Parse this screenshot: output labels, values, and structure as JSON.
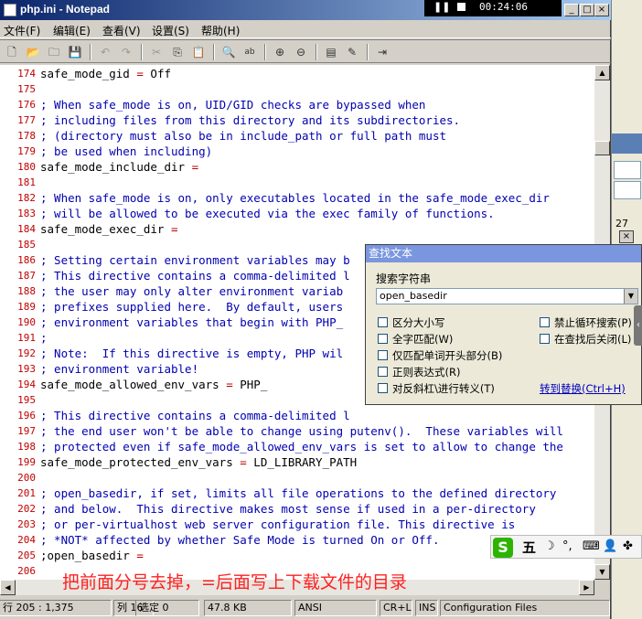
{
  "window": {
    "title": "php.ini - Notepad",
    "caption_buttons": [
      "_",
      "□",
      "×"
    ]
  },
  "media_overlay": {
    "time": "00:24:06"
  },
  "menu": [
    "文件(F)",
    "编辑(E)",
    "查看(V)",
    "设置(S)",
    "帮助(H)"
  ],
  "editor": {
    "lines": [
      {
        "n": "174",
        "key": "safe_mode_gid",
        "op": " = ",
        "val": "Off"
      },
      {
        "n": "175",
        "text": ""
      },
      {
        "n": "176",
        "comment": "; When safe_mode is on, UID/GID checks are bypassed when"
      },
      {
        "n": "177",
        "comment": "; including files from this directory and its subdirectories."
      },
      {
        "n": "178",
        "comment": "; (directory must also be in include_path or full path must"
      },
      {
        "n": "179",
        "comment": "; be used when including)"
      },
      {
        "n": "180",
        "key": "safe_mode_include_dir",
        "op": " =",
        "val": ""
      },
      {
        "n": "181",
        "text": ""
      },
      {
        "n": "182",
        "comment": "; When safe_mode is on, only executables located in the safe_mode_exec_dir"
      },
      {
        "n": "183",
        "comment": "; will be allowed to be executed via the exec family of functions."
      },
      {
        "n": "184",
        "key": "safe_mode_exec_dir",
        "op": " =",
        "val": ""
      },
      {
        "n": "185",
        "text": ""
      },
      {
        "n": "186",
        "comment": "; Setting certain environment variables may b"
      },
      {
        "n": "187",
        "comment": "; This directive contains a comma-delimited l"
      },
      {
        "n": "188",
        "comment": "; the user may only alter environment variab"
      },
      {
        "n": "189",
        "comment": "; prefixes supplied here.  By default, users"
      },
      {
        "n": "190",
        "comment": "; environment variables that begin with PHP_"
      },
      {
        "n": "191",
        "comment": ";"
      },
      {
        "n": "192",
        "comment": "; Note:  If this directive is empty, PHP wil"
      },
      {
        "n": "193",
        "comment": "; environment variable!"
      },
      {
        "n": "194",
        "key": "safe_mode_allowed_env_vars",
        "op": " = ",
        "val": "PHP_"
      },
      {
        "n": "195",
        "text": ""
      },
      {
        "n": "196",
        "comment": "; This directive contains a comma-delimited l"
      },
      {
        "n": "197",
        "comment": "; the end user won't be able to change using putenv().  These variables will"
      },
      {
        "n": "198",
        "comment": "; protected even if safe_mode_allowed_env_vars is set to allow to change the"
      },
      {
        "n": "199",
        "key": "safe_mode_protected_env_vars",
        "op": " = ",
        "val": "LD_LIBRARY_PATH"
      },
      {
        "n": "200",
        "text": ""
      },
      {
        "n": "201",
        "comment": "; open_basedir, if set, limits all file operations to the defined directory"
      },
      {
        "n": "202",
        "comment": "; and below.  This directive makes most sense if used in a per-directory"
      },
      {
        "n": "203",
        "comment": "; or per-virtualhost web server configuration file. This directive is"
      },
      {
        "n": "204",
        "comment": "; *NOT* affected by whether Safe Mode is turned On or Off."
      },
      {
        "n": "205",
        "key": ";open_basedir",
        "op": " =",
        "val": ""
      },
      {
        "n": "206",
        "text": ""
      }
    ]
  },
  "annotation": "把前面分号去掉，=后面写上下载文件的目录",
  "statusbar": {
    "position": "行 205 : 1,375",
    "column": "列 16",
    "selection": "选定 0",
    "size": "47.8 KB",
    "encoding": "ANSI",
    "line_ending": "CR+LF",
    "mode": "INS",
    "scheme": "Configuration Files"
  },
  "find_dialog": {
    "title": "查找文本",
    "search_label": "搜索字符串",
    "search_value": "open_basedir",
    "options_left": [
      "区分大小写",
      "全字匹配(W)",
      "仅匹配单词开头部分(B)",
      "正则表达式(R)",
      "对反斜杠\\进行转义(T)"
    ],
    "options_right": [
      "禁止循环搜索(P)",
      "在查找后关闭(L)"
    ],
    "replace_link": "转到替换(Ctrl+H)"
  },
  "right_panel": {
    "number": "27"
  },
  "ime": {
    "logo": "S",
    "mode": "五"
  },
  "icons": {
    "toolbar": [
      "new-file-icon",
      "open-icon",
      "find-file-icon",
      "save-icon",
      "undo-icon",
      "redo-icon",
      "cut-icon",
      "copy-icon",
      "paste-icon",
      "find-icon",
      "replace-icon",
      "zoom-in-icon",
      "zoom-out-icon",
      "view-icon",
      "scheme-icon",
      "exit-icon"
    ]
  }
}
